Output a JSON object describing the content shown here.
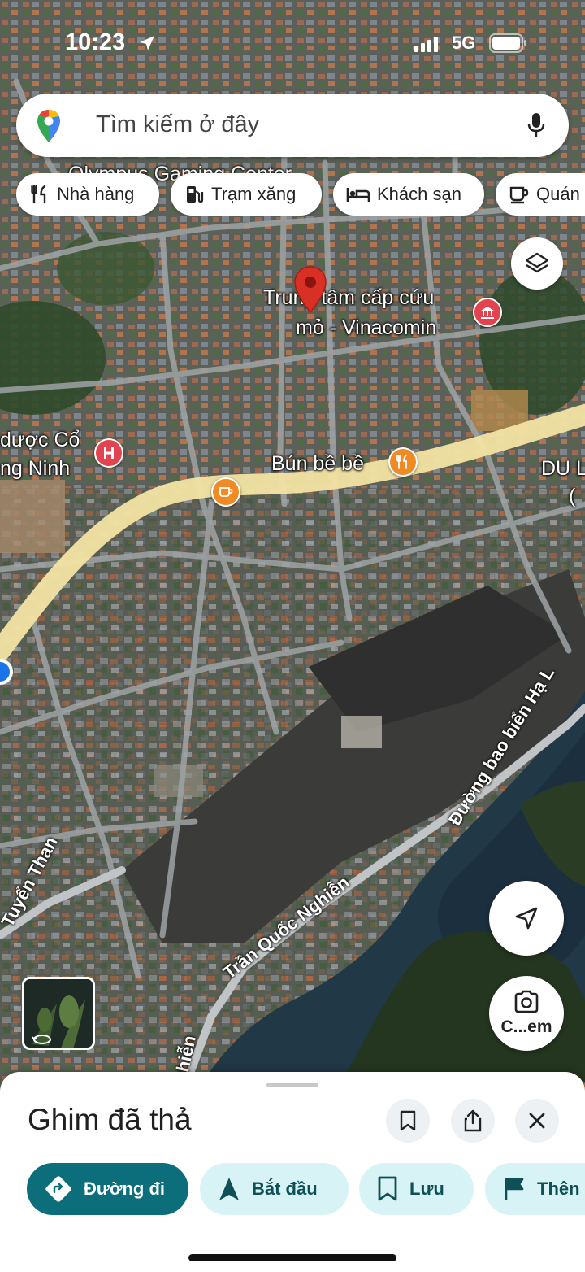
{
  "status_bar": {
    "time": "10:23",
    "network": "5G"
  },
  "search": {
    "placeholder": "Tìm kiếm ở đây"
  },
  "chips": [
    {
      "label": "Nhà hàng",
      "icon": "fork-knife-icon"
    },
    {
      "label": "Trạm xăng",
      "icon": "gas-pump-icon"
    },
    {
      "label": "Khách sạn",
      "icon": "bed-icon"
    },
    {
      "label": "Quán",
      "icon": "cup-icon"
    }
  ],
  "map": {
    "labels": {
      "olympus": "Olympus Gaming Center",
      "rescue_line1": "Trung tâm cấp cứu",
      "rescue_line2": "mỏ - Vinacomin",
      "pharmacy_line1": "dược Cổ",
      "pharmacy_line2": "ng Ninh",
      "bun_be_be": "Bún bề bề",
      "du_l": "DU L",
      "paren": "("
    },
    "streets": {
      "tuyen_than": "Tuyển Than",
      "tran_quoc_nghien": "Trần Quốc Nghiễn",
      "duong_bao_bien": "Đường bao biển Hạ L",
      "nghien": "ghiễn"
    },
    "colors": {
      "highlight_road": "#f3e3a3",
      "pin": "#d93025",
      "restaurant_poi": "#f08a24",
      "hospital_poi": "#e2434f",
      "museum_poi": "#e2434f"
    }
  },
  "controls": {
    "camera_label": "C...em"
  },
  "sheet": {
    "title": "Ghim đã thả",
    "actions": [
      {
        "label": "Đường đi",
        "icon": "directions-icon"
      },
      {
        "label": "Bắt đầu",
        "icon": "navigation-arrow-icon"
      },
      {
        "label": "Lưu",
        "icon": "bookmark-icon"
      },
      {
        "label": "Thên",
        "icon": "flag-icon"
      }
    ]
  }
}
